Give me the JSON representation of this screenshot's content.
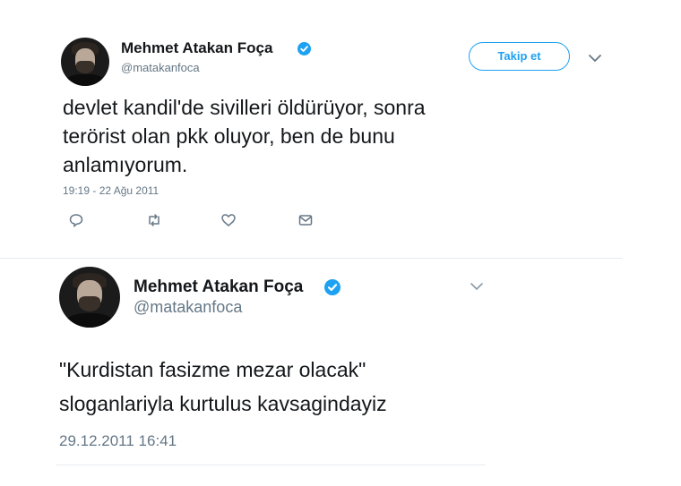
{
  "tweets": [
    {
      "author_name": "Mehmet Atakan Foça",
      "handle": "@matakanfoca",
      "follow_label": "Takip et",
      "text_lines": [
        "devlet kandil'de sivilleri öldürüyor, sonra",
        "terörist olan pkk oluyor, ben de bunu",
        "anlamıyorum."
      ],
      "timestamp": "19:19 - 22 Ağu 2011",
      "actions": [
        "reply-icon",
        "retweet-icon",
        "like-icon",
        "dm-icon"
      ]
    },
    {
      "author_name": "Mehmet Atakan Foça",
      "handle": "@matakanfoca",
      "text_lines": [
        "\"Kurdistan fasizme mezar olacak\"",
        "sloganlariyla kurtulus kavsagindayiz"
      ],
      "timestamp": "29.12.2011 16:41"
    }
  ],
  "colors": {
    "accent": "#1da1f2",
    "text": "#14171a",
    "secondary": "#657786",
    "divider": "#e6ecf0"
  }
}
